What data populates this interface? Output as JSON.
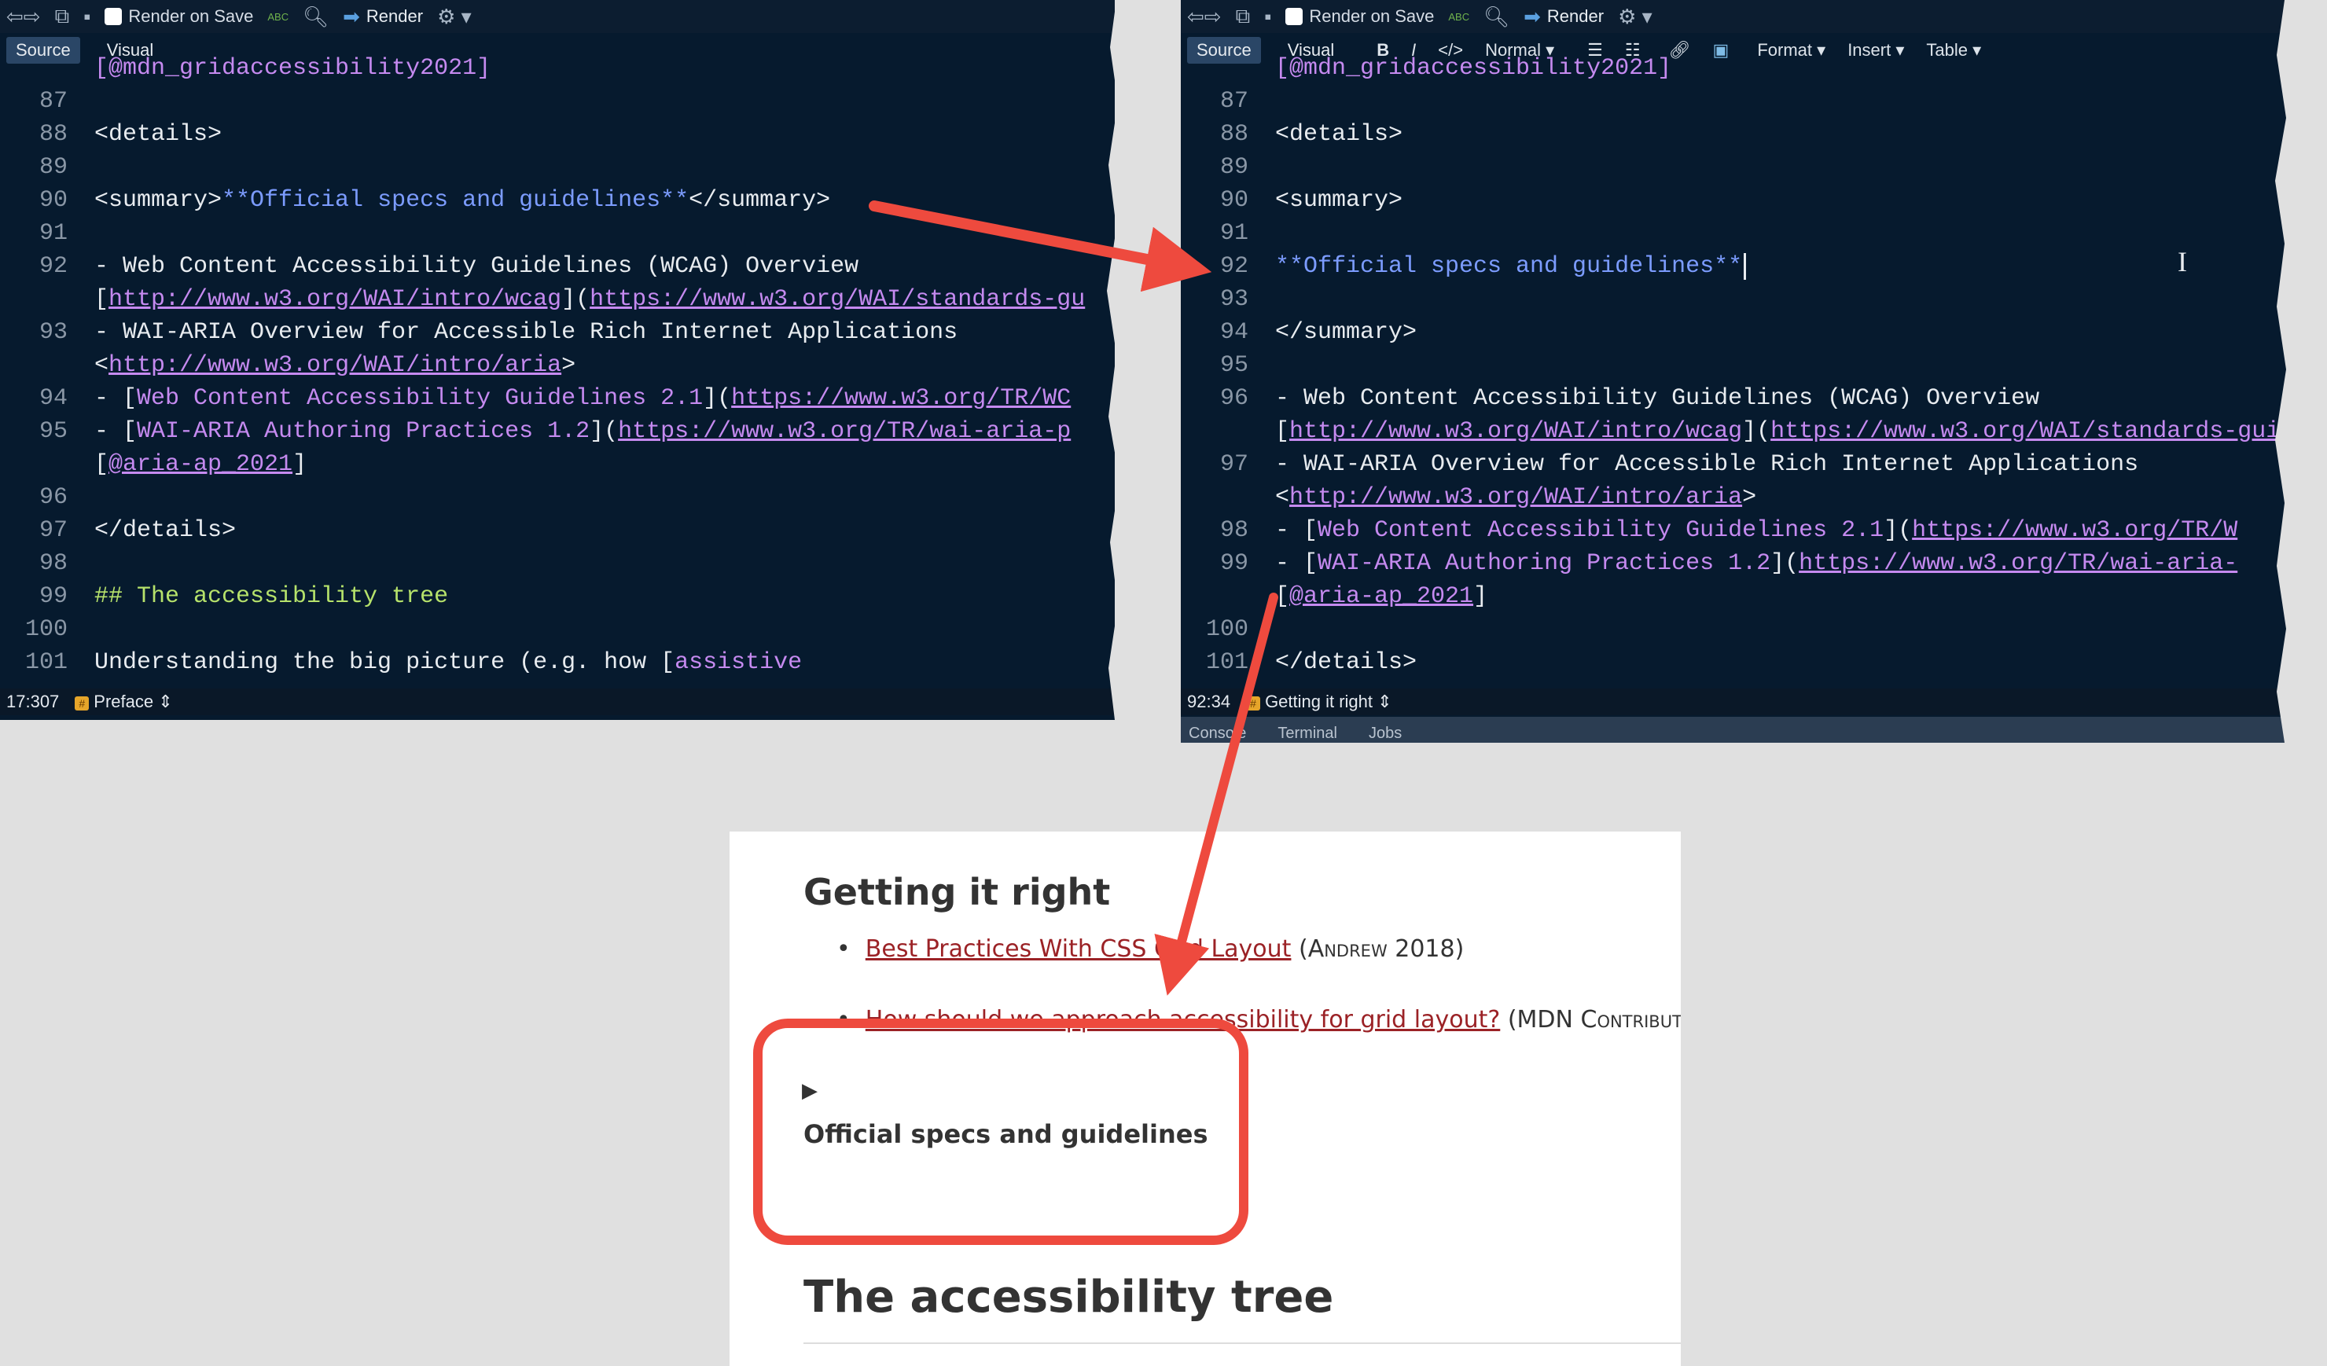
{
  "toolbar": {
    "render_on_save": "Render on Save",
    "render": "Render",
    "spell_label": "ABC"
  },
  "tabs": {
    "source": "Source",
    "visual": "Visual"
  },
  "visual_toolbar": {
    "bold": "B",
    "italic": "I",
    "code": "</>",
    "style": "Normal",
    "format": "Format",
    "insert": "Insert",
    "table": "Table"
  },
  "left_editor": {
    "top_partial": "[@mdn_gridaccessibility2021]",
    "lines": [
      {
        "n": "87",
        "t": ""
      },
      {
        "n": "88",
        "t": "<details>"
      },
      {
        "n": "89",
        "t": ""
      },
      {
        "n": "90",
        "a": "<summary>",
        "b": "**Official specs and guidelines**",
        "c": "</summary>"
      },
      {
        "n": "91",
        "t": ""
      },
      {
        "n": "92",
        "t": "-   Web Content Accessibility Guidelines (WCAG) Overview"
      },
      {
        "n": "",
        "a": "[",
        "b": "http://www.w3.org/WAI/intro/wcag",
        "c": "](",
        "d": "https://www.w3.org/WAI/standards-gu"
      },
      {
        "n": "93",
        "t": "-   WAI-ARIA Overview for Accessible Rich Internet Applications"
      },
      {
        "n": "",
        "a": "<",
        "b": "http://www.w3.org/WAI/intro/aria",
        "c": ">"
      },
      {
        "n": "94",
        "a": "-   [",
        "b": "Web Content Accessibility Guidelines 2.1",
        "c": "](",
        "d": "https://www.w3.org/TR/WC"
      },
      {
        "n": "95",
        "a": "-   [",
        "b": "WAI-ARIA Authoring Practices 1.2",
        "c": "](",
        "d": "https://www.w3.org/TR/wai-aria-p"
      },
      {
        "n": "",
        "a": "[",
        "b": "@aria-ap_2021",
        "c": "]"
      },
      {
        "n": "96",
        "t": ""
      },
      {
        "n": "97",
        "t": "</details>"
      },
      {
        "n": "98",
        "t": ""
      },
      {
        "n": "99",
        "h": "## The accessibility tree"
      },
      {
        "n": "100",
        "t": ""
      },
      {
        "n": "101",
        "a": "Understanding the big picture (e.g. how [",
        "b": "assistive"
      }
    ],
    "status_pos": "17:307",
    "status_section": "Preface"
  },
  "right_editor": {
    "top_partial": "[@mdn_gridaccessibility2021]",
    "lines": [
      {
        "n": "87",
        "t": ""
      },
      {
        "n": "88",
        "t": "<details>"
      },
      {
        "n": "89",
        "t": ""
      },
      {
        "n": "90",
        "t": "<summary>"
      },
      {
        "n": "91",
        "t": ""
      },
      {
        "n": "92",
        "b": "**Official specs and guidelines**"
      },
      {
        "n": "93",
        "t": ""
      },
      {
        "n": "94",
        "t": "</summary>"
      },
      {
        "n": "95",
        "t": ""
      },
      {
        "n": "96",
        "t": "-   Web Content Accessibility Guidelines (WCAG) Overview"
      },
      {
        "n": "",
        "a": "[",
        "b": "http://www.w3.org/WAI/intro/wcag",
        "c": "](",
        "d": "https://www.w3.org/WAI/standards-gui"
      },
      {
        "n": "97",
        "t": "-   WAI-ARIA Overview for Accessible Rich Internet Applications"
      },
      {
        "n": "",
        "a": "<",
        "b": "http://www.w3.org/WAI/intro/aria",
        "c": ">"
      },
      {
        "n": "98",
        "a": "-   [",
        "b": "Web Content Accessibility Guidelines 2.1",
        "c": "](",
        "d": "https://www.w3.org/TR/W"
      },
      {
        "n": "99",
        "a": "-   [",
        "b": "WAI-ARIA Authoring Practices 1.2",
        "c": "](",
        "d": "https://www.w3.org/TR/wai-aria-"
      },
      {
        "n": "",
        "a": "[",
        "b": "@aria-ap_2021",
        "c": "]"
      },
      {
        "n": "100",
        "t": ""
      },
      {
        "n": "101",
        "t": "</details>"
      }
    ],
    "status_pos": "92:34",
    "status_section": "Getting it right",
    "bottom_tabs": [
      "Console",
      "Terminal",
      "Jobs"
    ]
  },
  "rendered": {
    "heading": "Getting it right",
    "bullets": [
      {
        "link": "Best Practices With CSS Grid Layout",
        "cite": "(Andrew 2018)"
      },
      {
        "link": "How should we approach accessibility for grid layout?",
        "cite": "(MDN Contributors"
      }
    ],
    "disclosure_marker": "▶",
    "summary": "Official specs and guidelines",
    "next_heading": "The accessibility tree"
  },
  "colors": {
    "editor_bg": "#061a2e",
    "arrow": "#ee4a3e",
    "link": "#9b2226"
  }
}
